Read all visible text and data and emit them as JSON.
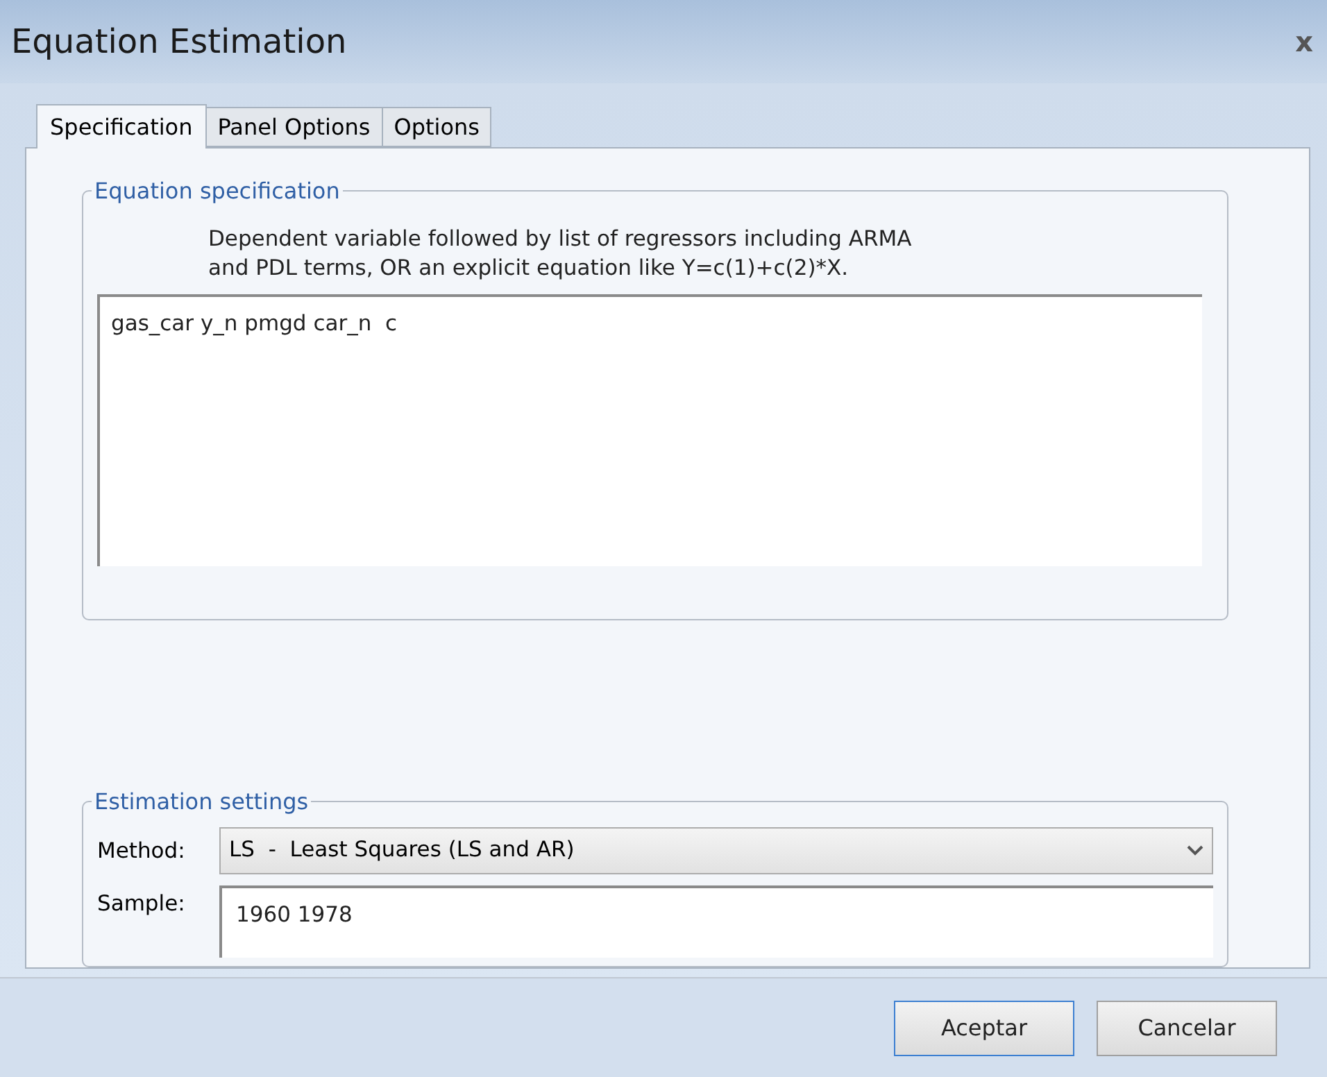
{
  "window": {
    "title": "Equation Estimation",
    "close": "x"
  },
  "tabs": [
    {
      "label": "Specification",
      "selected": true
    },
    {
      "label": "Panel Options",
      "selected": false
    },
    {
      "label": "Options",
      "selected": false
    }
  ],
  "equation_specification": {
    "legend": "Equation specification",
    "hint": "Dependent variable followed by list of regressors including ARMA\nand PDL terms, OR an explicit equation like Y=c(1)+c(2)*X.",
    "value": "gas_car y_n pmgd car_n  c"
  },
  "estimation_settings": {
    "legend": "Estimation settings",
    "method_label": "Method:",
    "method": "LS  -  Least Squares (LS and AR)",
    "sample_label": "Sample:",
    "sample": "1960 1978"
  },
  "buttons": [
    {
      "label": "Aceptar",
      "default": true
    },
    {
      "label": "Cancelar",
      "default": false
    }
  ]
}
